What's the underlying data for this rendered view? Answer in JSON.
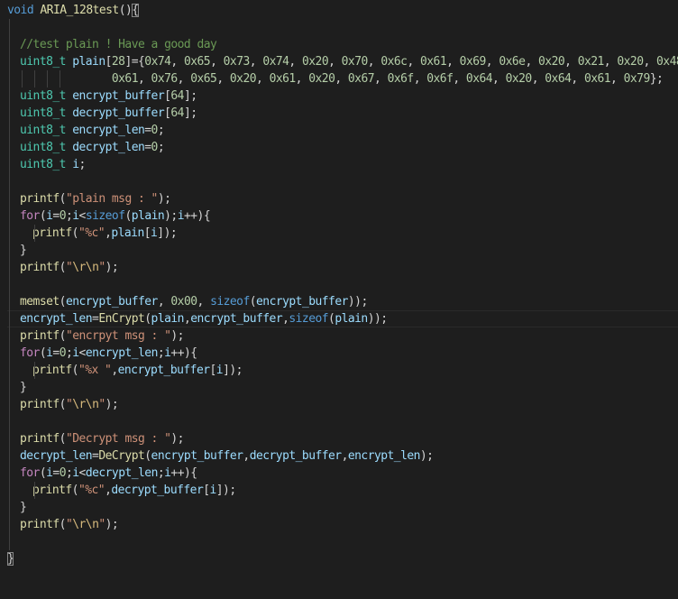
{
  "editor": {
    "background": "#1e1e1e",
    "current_line_index": 18,
    "lines": [
      {
        "indent": 0,
        "tokens": [
          [
            "void",
            "kw"
          ],
          [
            " ",
            "p"
          ],
          [
            "ARIA_128test",
            "fn"
          ],
          [
            "()",
            "p"
          ],
          [
            "{",
            "brace"
          ]
        ]
      },
      {
        "indent": 1,
        "tokens": []
      },
      {
        "indent": 1,
        "tokens": [
          [
            "//test plain ! Have a good day",
            "cm"
          ]
        ]
      },
      {
        "indent": 1,
        "tokens": [
          [
            "uint8_t",
            "ty"
          ],
          [
            " ",
            "p"
          ],
          [
            "plain",
            "var"
          ],
          [
            "[",
            "p"
          ],
          [
            "28",
            "num"
          ],
          [
            "]={",
            "p"
          ],
          [
            "0x74",
            "num"
          ],
          [
            ", ",
            "p"
          ],
          [
            "0x65",
            "num"
          ],
          [
            ", ",
            "p"
          ],
          [
            "0x73",
            "num"
          ],
          [
            ", ",
            "p"
          ],
          [
            "0x74",
            "num"
          ],
          [
            ", ",
            "p"
          ],
          [
            "0x20",
            "num"
          ],
          [
            ", ",
            "p"
          ],
          [
            "0x70",
            "num"
          ],
          [
            ", ",
            "p"
          ],
          [
            "0x6c",
            "num"
          ],
          [
            ", ",
            "p"
          ],
          [
            "0x61",
            "num"
          ],
          [
            ", ",
            "p"
          ],
          [
            "0x69",
            "num"
          ],
          [
            ", ",
            "p"
          ],
          [
            "0x6e",
            "num"
          ],
          [
            ", ",
            "p"
          ],
          [
            "0x20",
            "num"
          ],
          [
            ", ",
            "p"
          ],
          [
            "0x21",
            "num"
          ],
          [
            ", ",
            "p"
          ],
          [
            "0x20",
            "num"
          ],
          [
            ", ",
            "p"
          ],
          [
            "0x48",
            "num"
          ],
          [
            ",",
            "p"
          ]
        ]
      },
      {
        "indent": 1,
        "pad": "              ",
        "guides": 5,
        "tokens": [
          [
            "0x61",
            "num"
          ],
          [
            ", ",
            "p"
          ],
          [
            "0x76",
            "num"
          ],
          [
            ", ",
            "p"
          ],
          [
            "0x65",
            "num"
          ],
          [
            ", ",
            "p"
          ],
          [
            "0x20",
            "num"
          ],
          [
            ", ",
            "p"
          ],
          [
            "0x61",
            "num"
          ],
          [
            ", ",
            "p"
          ],
          [
            "0x20",
            "num"
          ],
          [
            ", ",
            "p"
          ],
          [
            "0x67",
            "num"
          ],
          [
            ", ",
            "p"
          ],
          [
            "0x6f",
            "num"
          ],
          [
            ", ",
            "p"
          ],
          [
            "0x6f",
            "num"
          ],
          [
            ", ",
            "p"
          ],
          [
            "0x64",
            "num"
          ],
          [
            ", ",
            "p"
          ],
          [
            "0x20",
            "num"
          ],
          [
            ", ",
            "p"
          ],
          [
            "0x64",
            "num"
          ],
          [
            ", ",
            "p"
          ],
          [
            "0x61",
            "num"
          ],
          [
            ", ",
            "p"
          ],
          [
            "0x79",
            "num"
          ],
          [
            "};",
            "p"
          ]
        ]
      },
      {
        "indent": 1,
        "tokens": [
          [
            "uint8_t",
            "ty"
          ],
          [
            " ",
            "p"
          ],
          [
            "encrypt_buffer",
            "var"
          ],
          [
            "[",
            "p"
          ],
          [
            "64",
            "num"
          ],
          [
            "];",
            "p"
          ]
        ]
      },
      {
        "indent": 1,
        "tokens": [
          [
            "uint8_t",
            "ty"
          ],
          [
            " ",
            "p"
          ],
          [
            "decrypt_buffer",
            "var"
          ],
          [
            "[",
            "p"
          ],
          [
            "64",
            "num"
          ],
          [
            "];",
            "p"
          ]
        ]
      },
      {
        "indent": 1,
        "tokens": [
          [
            "uint8_t",
            "ty"
          ],
          [
            " ",
            "p"
          ],
          [
            "encrypt_len",
            "var"
          ],
          [
            "=",
            "p"
          ],
          [
            "0",
            "num"
          ],
          [
            ";",
            "p"
          ]
        ]
      },
      {
        "indent": 1,
        "tokens": [
          [
            "uint8_t",
            "ty"
          ],
          [
            " ",
            "p"
          ],
          [
            "decrypt_len",
            "var"
          ],
          [
            "=",
            "p"
          ],
          [
            "0",
            "num"
          ],
          [
            ";",
            "p"
          ]
        ]
      },
      {
        "indent": 1,
        "tokens": [
          [
            "uint8_t",
            "ty"
          ],
          [
            " ",
            "p"
          ],
          [
            "i",
            "var"
          ],
          [
            ";",
            "p"
          ]
        ]
      },
      {
        "indent": 1,
        "tokens": []
      },
      {
        "indent": 1,
        "tokens": [
          [
            "printf",
            "fn"
          ],
          [
            "(",
            "p"
          ],
          [
            "\"plain msg : \"",
            "str"
          ],
          [
            ");",
            "p"
          ]
        ]
      },
      {
        "indent": 1,
        "tokens": [
          [
            "for",
            "ctl"
          ],
          [
            "(",
            "p"
          ],
          [
            "i",
            "var"
          ],
          [
            "=",
            "p"
          ],
          [
            "0",
            "num"
          ],
          [
            ";",
            "p"
          ],
          [
            "i",
            "var"
          ],
          [
            "<",
            "p"
          ],
          [
            "sizeof",
            "kw"
          ],
          [
            "(",
            "p"
          ],
          [
            "plain",
            "var"
          ],
          [
            ");",
            "p"
          ],
          [
            "i",
            "var"
          ],
          [
            "++){",
            "p"
          ]
        ]
      },
      {
        "indent": 2,
        "tokens": [
          [
            "printf",
            "fn"
          ],
          [
            "(",
            "p"
          ],
          [
            "\"%c\"",
            "str"
          ],
          [
            ",",
            "p"
          ],
          [
            "plain",
            "var"
          ],
          [
            "[",
            "p"
          ],
          [
            "i",
            "var"
          ],
          [
            "]);",
            "p"
          ]
        ]
      },
      {
        "indent": 1,
        "tokens": [
          [
            "}",
            "p"
          ]
        ]
      },
      {
        "indent": 1,
        "tokens": [
          [
            "printf",
            "fn"
          ],
          [
            "(",
            "p"
          ],
          [
            "\"",
            "str"
          ],
          [
            "\\r\\n",
            "esc"
          ],
          [
            "\"",
            "str"
          ],
          [
            ");",
            "p"
          ]
        ]
      },
      {
        "indent": 1,
        "tokens": []
      },
      {
        "indent": 1,
        "tokens": [
          [
            "memset",
            "fn"
          ],
          [
            "(",
            "p"
          ],
          [
            "encrypt_buffer",
            "var"
          ],
          [
            ", ",
            "p"
          ],
          [
            "0x00",
            "num"
          ],
          [
            ", ",
            "p"
          ],
          [
            "sizeof",
            "kw"
          ],
          [
            "(",
            "p"
          ],
          [
            "encrypt_buffer",
            "var"
          ],
          [
            "));",
            "p"
          ]
        ]
      },
      {
        "indent": 1,
        "tokens": [
          [
            "encrypt_len",
            "var"
          ],
          [
            "=",
            "p"
          ],
          [
            "EnCrypt",
            "fn"
          ],
          [
            "(",
            "p"
          ],
          [
            "plain",
            "var"
          ],
          [
            ",",
            "p"
          ],
          [
            "encrypt_buffer",
            "var"
          ],
          [
            ",",
            "p"
          ],
          [
            "sizeof",
            "kw"
          ],
          [
            "(",
            "p"
          ],
          [
            "plain",
            "var"
          ],
          [
            "));",
            "p"
          ]
        ]
      },
      {
        "indent": 1,
        "tokens": [
          [
            "printf",
            "fn"
          ],
          [
            "(",
            "p"
          ],
          [
            "\"encrpyt msg : \"",
            "str"
          ],
          [
            ");",
            "p"
          ]
        ]
      },
      {
        "indent": 1,
        "tokens": [
          [
            "for",
            "ctl"
          ],
          [
            "(",
            "p"
          ],
          [
            "i",
            "var"
          ],
          [
            "=",
            "p"
          ],
          [
            "0",
            "num"
          ],
          [
            ";",
            "p"
          ],
          [
            "i",
            "var"
          ],
          [
            "<",
            "p"
          ],
          [
            "encrypt_len",
            "var"
          ],
          [
            ";",
            "p"
          ],
          [
            "i",
            "var"
          ],
          [
            "++){",
            "p"
          ]
        ]
      },
      {
        "indent": 2,
        "tokens": [
          [
            "printf",
            "fn"
          ],
          [
            "(",
            "p"
          ],
          [
            "\"%x \"",
            "str"
          ],
          [
            ",",
            "p"
          ],
          [
            "encrypt_buffer",
            "var"
          ],
          [
            "[",
            "p"
          ],
          [
            "i",
            "var"
          ],
          [
            "]);",
            "p"
          ]
        ]
      },
      {
        "indent": 1,
        "tokens": [
          [
            "}",
            "p"
          ]
        ]
      },
      {
        "indent": 1,
        "tokens": [
          [
            "printf",
            "fn"
          ],
          [
            "(",
            "p"
          ],
          [
            "\"",
            "str"
          ],
          [
            "\\r\\n",
            "esc"
          ],
          [
            "\"",
            "str"
          ],
          [
            ");",
            "p"
          ]
        ]
      },
      {
        "indent": 1,
        "tokens": []
      },
      {
        "indent": 1,
        "tokens": [
          [
            "printf",
            "fn"
          ],
          [
            "(",
            "p"
          ],
          [
            "\"Decrypt msg : \"",
            "str"
          ],
          [
            ");",
            "p"
          ]
        ]
      },
      {
        "indent": 1,
        "tokens": [
          [
            "decrypt_len",
            "var"
          ],
          [
            "=",
            "p"
          ],
          [
            "DeCrypt",
            "fn"
          ],
          [
            "(",
            "p"
          ],
          [
            "encrypt_buffer",
            "var"
          ],
          [
            ",",
            "p"
          ],
          [
            "decrypt_buffer",
            "var"
          ],
          [
            ",",
            "p"
          ],
          [
            "encrypt_len",
            "var"
          ],
          [
            ");",
            "p"
          ]
        ]
      },
      {
        "indent": 1,
        "tokens": [
          [
            "for",
            "ctl"
          ],
          [
            "(",
            "p"
          ],
          [
            "i",
            "var"
          ],
          [
            "=",
            "p"
          ],
          [
            "0",
            "num"
          ],
          [
            ";",
            "p"
          ],
          [
            "i",
            "var"
          ],
          [
            "<",
            "p"
          ],
          [
            "decrypt_len",
            "var"
          ],
          [
            ";",
            "p"
          ],
          [
            "i",
            "var"
          ],
          [
            "++){",
            "p"
          ]
        ]
      },
      {
        "indent": 2,
        "tokens": [
          [
            "printf",
            "fn"
          ],
          [
            "(",
            "p"
          ],
          [
            "\"%c\"",
            "str"
          ],
          [
            ",",
            "p"
          ],
          [
            "decrypt_buffer",
            "var"
          ],
          [
            "[",
            "p"
          ],
          [
            "i",
            "var"
          ],
          [
            "]);",
            "p"
          ]
        ]
      },
      {
        "indent": 1,
        "tokens": [
          [
            "}",
            "p"
          ]
        ]
      },
      {
        "indent": 1,
        "tokens": [
          [
            "printf",
            "fn"
          ],
          [
            "(",
            "p"
          ],
          [
            "\"",
            "str"
          ],
          [
            "\\r\\n",
            "esc"
          ],
          [
            "\"",
            "str"
          ],
          [
            ");",
            "p"
          ]
        ]
      },
      {
        "indent": 1,
        "tokens": []
      },
      {
        "indent": 0,
        "tokens": [
          [
            "}",
            "brace"
          ]
        ]
      }
    ]
  }
}
